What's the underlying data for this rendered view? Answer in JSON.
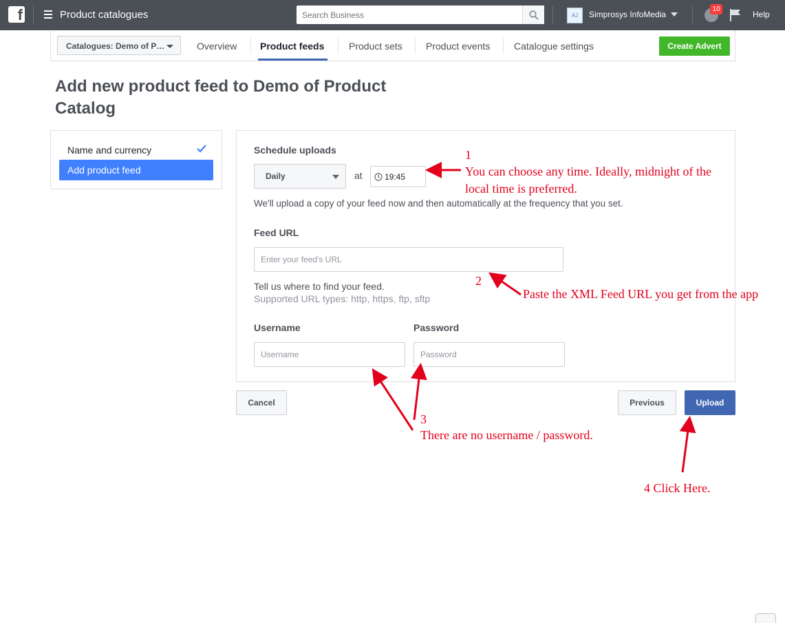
{
  "topbar": {
    "app_title": "Product catalogues",
    "search_placeholder": "Search Business",
    "account_initials": "AJ",
    "account_name": "Simprosys InfoMedia",
    "notification_count": "10",
    "help_label": "Help"
  },
  "subnav": {
    "catalogue_select": "Catalogues: Demo of P…",
    "tabs": [
      {
        "label": "Overview",
        "active": false
      },
      {
        "label": "Product feeds",
        "active": true
      },
      {
        "label": "Product sets",
        "active": false
      },
      {
        "label": "Product events",
        "active": false
      },
      {
        "label": "Catalogue settings",
        "active": false
      }
    ],
    "create_advert": "Create Advert"
  },
  "page": {
    "title": "Add new product feed to Demo of Product Catalog"
  },
  "steps": [
    {
      "label": "Name and currency",
      "completed": true
    },
    {
      "label": "Add product feed",
      "active": true
    }
  ],
  "form": {
    "schedule_label": "Schedule uploads",
    "frequency": "Daily",
    "at_label": "at",
    "time": "19:45",
    "schedule_help": "We'll upload a copy of your feed now and then automatically at the frequency that you set.",
    "feed_url_label": "Feed URL",
    "feed_url_placeholder": "Enter your feed's URL",
    "feed_url_help": "Tell us where to find your feed.",
    "feed_url_types": "Supported URL types: http, https, ftp, sftp",
    "username_label": "Username",
    "username_placeholder": "Username",
    "password_label": "Password",
    "password_placeholder": "Password"
  },
  "buttons": {
    "cancel": "Cancel",
    "previous": "Previous",
    "upload": "Upload"
  },
  "annotations": {
    "a1_number": "1",
    "a1_line1": "You can choose any time. Ideally, midnight of the",
    "a1_line2": "local time is preferred.",
    "a2_number": "2",
    "a2_text": "Paste the XML Feed URL you get from the app",
    "a3_number": "3",
    "a3_text": "There are no username / password.",
    "a4_text": "4  Click Here."
  },
  "colors": {
    "topbar": "#4b4f56",
    "accent_blue": "#4267b2",
    "active_step": "#4080ff",
    "create_green": "#42b72a",
    "annotation_red": "#e3001b"
  }
}
